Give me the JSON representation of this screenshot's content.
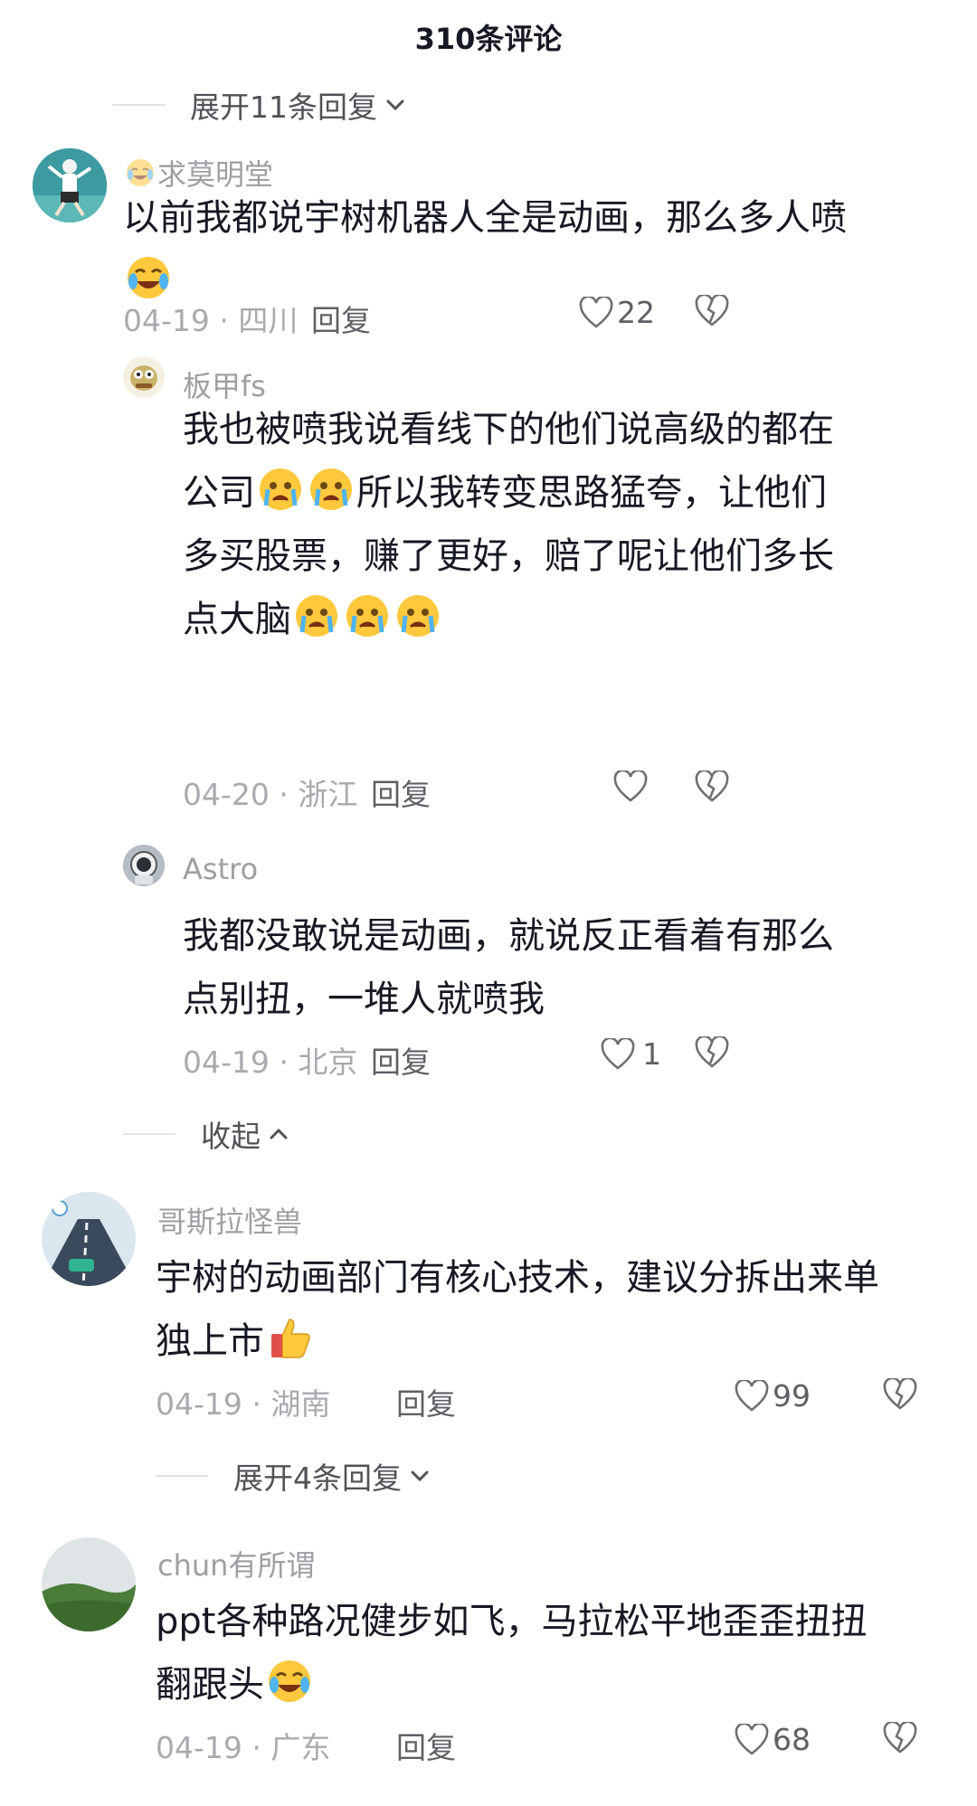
{
  "header": {
    "title": "310条评论"
  },
  "expand_top": {
    "label": "展开11条回复"
  },
  "comments": [
    {
      "username": "求莫明堂",
      "content": "以前我都说宇树机器人全是动画，那么多人喷",
      "date": "04-19",
      "location": "四川",
      "reply_label": "回复",
      "likes": "22",
      "avatar_icon": "person-jumping-avatar"
    },
    {
      "username": "板甲fs",
      "content_lines": [
        "我也被喷我说看线下的他们说高级的都在",
        "公司",
        "所以我转变思路猛夸，让他们",
        "多买股票，赚了更好，赔了呢让他们多长",
        "点大脑"
      ],
      "date": "04-20",
      "location": "浙江",
      "reply_label": "回复",
      "likes": "",
      "avatar_icon": "cartoon-avatar"
    },
    {
      "username": "Astro",
      "content_lines": [
        "我都没敢说是动画，就说反正看着有那么",
        "点别扭，一堆人就喷我"
      ],
      "date": "04-19",
      "location": "北京",
      "reply_label": "回复",
      "likes": "1",
      "avatar_icon": "astronaut-avatar"
    },
    {
      "username": "哥斯拉怪兽",
      "content_lines": [
        "宇树的动画部门有核心技术，建议分拆出来单",
        "独上市"
      ],
      "date": "04-19",
      "location": "湖南",
      "reply_label": "回复",
      "likes": "99",
      "avatar_icon": "road-avatar"
    },
    {
      "username": "chun有所谓",
      "content_lines": [
        "ppt各种路况健步如飞，马拉松平地歪歪扭扭",
        "翻跟头"
      ],
      "date": "04-19",
      "location": "广东",
      "reply_label": "回复",
      "likes": "68",
      "avatar_icon": "landscape-avatar"
    }
  ],
  "collapse": {
    "label": "收起"
  },
  "expand_mid": {
    "label": "展开4条回复"
  },
  "separator": "·",
  "colors": {
    "text": "#161823",
    "muted": "#a9aab0",
    "accent_emoji": "#ffc83d"
  }
}
